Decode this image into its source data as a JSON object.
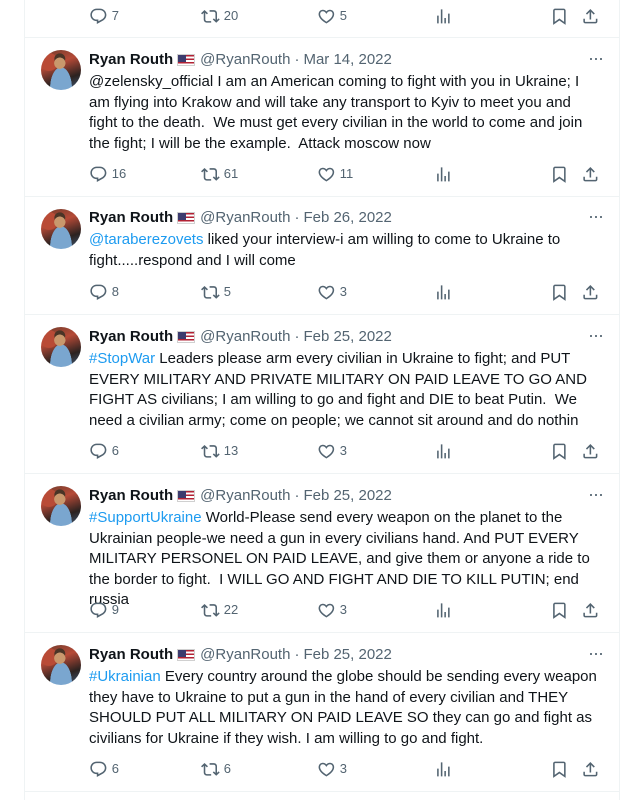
{
  "icons": {
    "reply": "reply-icon",
    "retweet": "retweet-icon",
    "like": "heart-icon",
    "views": "views-chart-icon",
    "bookmark": "bookmark-icon",
    "share": "share-icon",
    "more": "more-options-icon",
    "flag": "us-flag-icon"
  },
  "colors": {
    "link": "#1d9bf0",
    "secondary_text": "#536471",
    "primary_text": "#0f1419"
  },
  "top_bar": {
    "replies": "7",
    "retweets": "20",
    "likes": "5"
  },
  "tweets": [
    {
      "name": "Ryan Routh",
      "handle": "@RyanRouth",
      "separator": "·",
      "date": "Mar 14, 2022",
      "more": "···",
      "tag": "",
      "body": "@zelensky_official I am an American coming to fight with you in Ukraine; I am flying into Krakow and will take any transport to Kyiv to meet you and fight to the death.  We must get every civilian in the world to come and join the fight; I will be the example.  Attack moscow now",
      "replies": "16",
      "retweets": "61",
      "likes": "11"
    },
    {
      "name": "Ryan Routh",
      "handle": "@RyanRouth",
      "separator": "·",
      "date": "Feb 26, 2022",
      "more": "···",
      "tag": "@taraberezovets",
      "body": " liked your interview-i am willing to come to Ukraine to fight.....respond and I will come",
      "replies": "8",
      "retweets": "5",
      "likes": "3"
    },
    {
      "name": "Ryan Routh",
      "handle": "@RyanRouth",
      "separator": "·",
      "date": "Feb 25, 2022",
      "more": "···",
      "tag": "#StopWar",
      "body": " Leaders please arm every civilian in Ukraine to fight; and PUT EVERY MILITARY AND PRIVATE MILITARY ON PAID LEAVE TO GO AND FIGHT AS civilians; I am willing to go and fight and DIE to beat Putin.  We need a civilian army; come on people; we cannot sit around and do nothin",
      "replies": "6",
      "retweets": "13",
      "likes": "3"
    },
    {
      "name": "Ryan Routh",
      "handle": "@RyanRouth",
      "separator": "·",
      "date": "Feb 25, 2022",
      "more": "···",
      "tag": "#SupportUkraine",
      "body": " World-Please send every weapon on the planet to the Ukrainian people-we need a gun in every civilians hand. And PUT EVERY MILITARY PERSONEL ON PAID LEAVE, and give them or anyone a ride to the border to fight.  I WILL GO AND FIGHT AND DIE TO KILL PUTIN; end russia",
      "replies": "9",
      "retweets": "22",
      "likes": "3"
    },
    {
      "name": "Ryan Routh",
      "handle": "@RyanRouth",
      "separator": "·",
      "date": "Feb 25, 2022",
      "more": "···",
      "tag": "#Ukrainian",
      "body": " Every country around the globe should be sending every weapon they have to Ukraine to put a gun in the hand of every civilian and THEY SHOULD PUT ALL MILITARY ON PAID LEAVE SO they can go and fight as civilians for Ukraine if they wish. I am willing to go and fight.",
      "replies": "6",
      "retweets": "6",
      "likes": "3"
    }
  ]
}
